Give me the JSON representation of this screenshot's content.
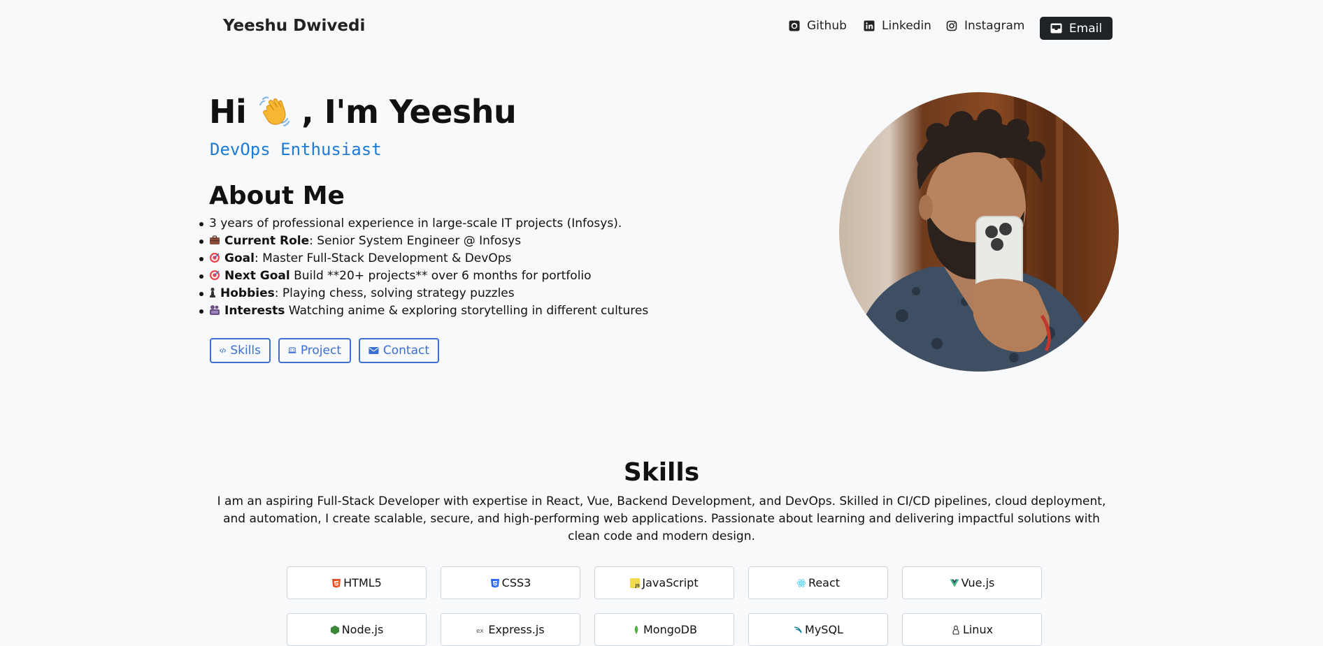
{
  "nav": {
    "brand": "Yeeshu Dwivedi",
    "links": [
      {
        "label": "Github",
        "icon": "github-icon"
      },
      {
        "label": "Linkedin",
        "icon": "linkedin-icon"
      },
      {
        "label": "Instagram",
        "icon": "instagram-icon"
      }
    ],
    "email_label": "Email"
  },
  "hero": {
    "greeting_pre": "Hi",
    "greeting_post": ", I'm Yeeshu",
    "subtitle": "DevOps Enthusiast"
  },
  "about": {
    "title": "About Me",
    "items": [
      {
        "icon": "",
        "bold": "",
        "text": "3 years of professional experience in large-scale IT projects (Infosys)."
      },
      {
        "icon": "briefcase-icon",
        "bold": "Current Role",
        "text": ": Senior System Engineer @ Infosys"
      },
      {
        "icon": "target-icon",
        "bold": "Goal",
        "text": ": Master Full-Stack Development & DevOps"
      },
      {
        "icon": "target-icon",
        "bold": "Next Goal",
        "text": " Build **20+ projects** over 6 months for portfolio"
      },
      {
        "icon": "chess-pawn-icon",
        "bold": "Hobbies",
        "text": ": Playing chess, solving strategy puzzles"
      },
      {
        "icon": "anime-icon",
        "bold": "Interests",
        "text": " Watching anime & exploring storytelling in different cultures"
      }
    ]
  },
  "buttons": {
    "skills": "Skills",
    "project": "Project",
    "contact": "Contact"
  },
  "skills": {
    "title": "Skills",
    "description": "I am an aspiring Full-Stack Developer with expertise in React, Vue, Backend Development, and DevOps. Skilled in CI/CD pipelines, cloud deployment, and automation, I create scalable, secure, and high-performing web applications. Passionate about learning and delivering impactful solutions with clean code and modern design.",
    "items": [
      {
        "label": "HTML5",
        "icon": "html5-icon",
        "color": "#e44d26"
      },
      {
        "label": "CSS3",
        "icon": "css3-icon",
        "color": "#2965f1"
      },
      {
        "label": "JavaScript",
        "icon": "javascript-icon",
        "color": "#f0db4f"
      },
      {
        "label": "React",
        "icon": "react-icon",
        "color": "#61dafb"
      },
      {
        "label": "Vue.js",
        "icon": "vue-icon",
        "color": "#42b883"
      },
      {
        "label": "Node.js",
        "icon": "nodejs-icon",
        "color": "#3c873a"
      },
      {
        "label": "Express.js",
        "icon": "express-icon",
        "color": "#555555"
      },
      {
        "label": "MongoDB",
        "icon": "mongodb-icon",
        "color": "#4db33d"
      },
      {
        "label": "MySQL",
        "icon": "mysql-icon",
        "color": "#00758f"
      },
      {
        "label": "Linux",
        "icon": "linux-icon",
        "color": "#222222"
      }
    ]
  },
  "colors": {
    "accent_blue": "#3b6fd4",
    "subtitle_blue": "#1d7ad6",
    "dark_button": "#1f2328",
    "background": "#f8f9fa"
  }
}
